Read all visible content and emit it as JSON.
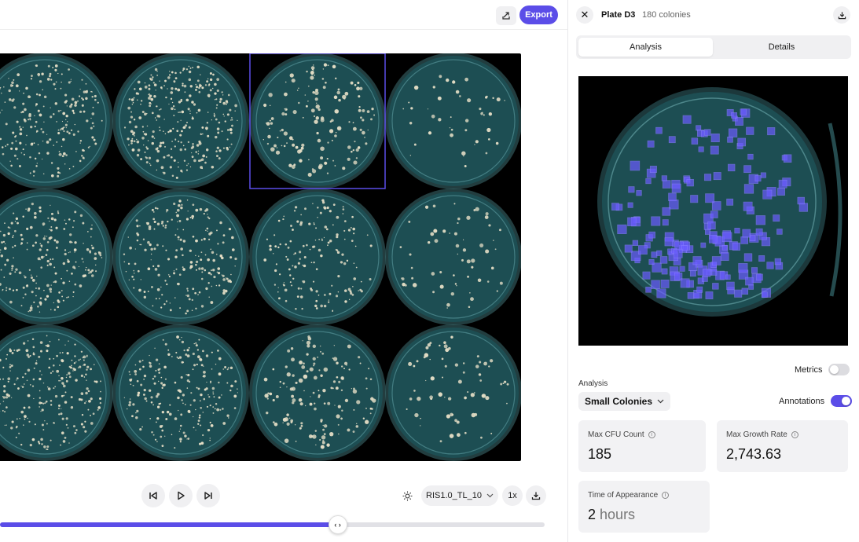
{
  "toolbar": {
    "export_label": "Export",
    "share_icon": "share-icon"
  },
  "plates_grid": {
    "selected_plate": "D3",
    "plate_density": [
      [
        240,
        320,
        150,
        45
      ],
      [
        230,
        220,
        160,
        60
      ],
      [
        260,
        230,
        150,
        70
      ]
    ]
  },
  "playback": {
    "timelapse_name": "RIS1.0_TL_10",
    "speed": "1x",
    "progress": 0.62,
    "handle_glyph": "‹ ›"
  },
  "panel": {
    "close_glyph": "✕",
    "title": "Plate D3",
    "subtitle": "180 colonies",
    "tabs": [
      {
        "label": "Analysis",
        "active": true
      },
      {
        "label": "Details",
        "active": false
      }
    ],
    "metrics_toggle": {
      "label": "Metrics",
      "on": false
    },
    "annotations_toggle": {
      "label": "Annotations",
      "on": true
    },
    "analysis_label": "Analysis",
    "analysis_value": "Small Colonies",
    "cards": {
      "max_cfu": {
        "label": "Max CFU Count",
        "value": "185"
      },
      "max_growth": {
        "label": "Max Growth Rate",
        "value": "2,743.63"
      },
      "time_appearance": {
        "label": "Time of Appearance",
        "value": "2",
        "unit": "hours"
      }
    }
  },
  "colors": {
    "accent": "#5b4de8",
    "plate_agar": "#1d4e53",
    "annotation_box": "#6b5cff"
  }
}
